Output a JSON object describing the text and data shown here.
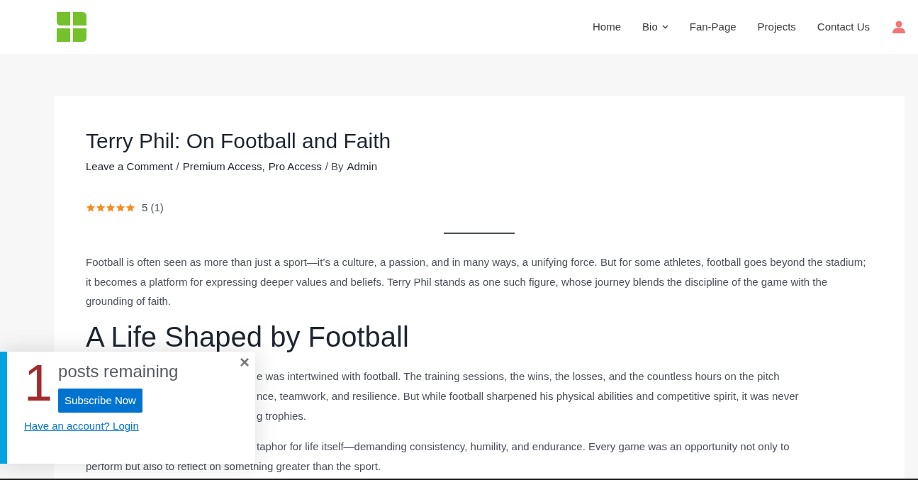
{
  "nav": {
    "items": [
      {
        "label": "Home",
        "has_dropdown": false
      },
      {
        "label": "Bio",
        "has_dropdown": true
      },
      {
        "label": "Fan-Page",
        "has_dropdown": false
      },
      {
        "label": "Projects",
        "has_dropdown": false
      },
      {
        "label": "Contact Us",
        "has_dropdown": false
      }
    ]
  },
  "article": {
    "title": "Terry Phil: On Football and Faith",
    "meta": [
      {
        "kind": "link",
        "text": "Leave a Comment"
      },
      {
        "kind": "text",
        "text": "/"
      },
      {
        "kind": "link",
        "text": "Premium Access,"
      },
      {
        "kind": "link",
        "text": "Pro Access"
      },
      {
        "kind": "text",
        "text": "/ By"
      },
      {
        "kind": "link",
        "text": "Admin"
      }
    ],
    "rating": {
      "stars": 5,
      "text": "5 (1)"
    },
    "intro": "Football is often seen as more than just a sport—it’s a culture, a passion, and in many ways, a unifying force. But for some athletes, football goes beyond the stadium; it becomes a platform for expressing deeper values and beliefs. Terry Phil stands as one such figure, whose journey blends the discipline of the game with the grounding of faith.",
    "section_heading": "A Life Shaped by Football",
    "paragraphs": [
      {
        "lines": [
          {
            "text": "e was intertwined with football. The training sessions, the wins, the losses, and the countless hours on the pitch",
            "covered": true
          },
          {
            "text": "nce, teamwork, and resilience. But while football sharpened his physical abilities and competitive spirit, it was never",
            "covered": true
          },
          {
            "text": "g trophies.",
            "covered": true
          }
        ]
      },
      {
        "lines": [
          {
            "text": "taphor for life itself—demanding consistency, humility, and endurance. Every game was an opportunity not only to",
            "covered": true
          },
          {
            "text": "perform but also to reflect on something greater than the sport.",
            "covered": false
          }
        ]
      }
    ]
  },
  "paywall": {
    "count": "1",
    "label": "posts remaining",
    "close": "×",
    "button": "Subscribe Now",
    "login_link": "Have an account? Login"
  }
}
